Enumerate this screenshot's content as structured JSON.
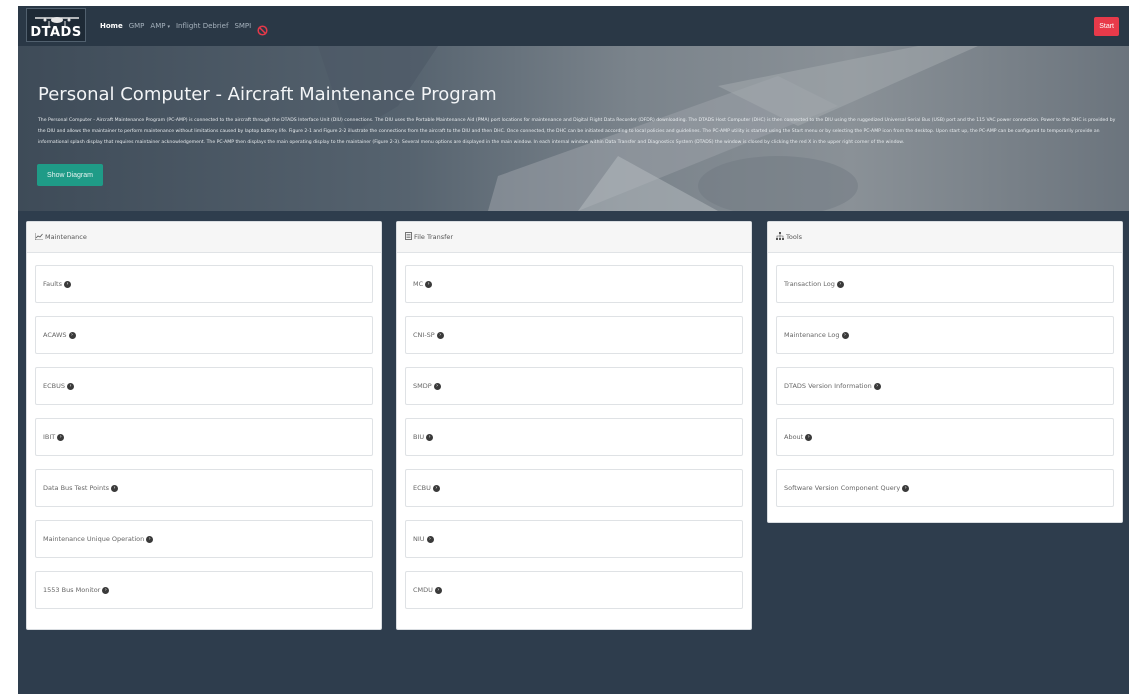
{
  "logo": {
    "text": "DTADS"
  },
  "nav": {
    "items": [
      {
        "label": "Home",
        "active": true
      },
      {
        "label": "GMP",
        "active": false
      },
      {
        "label": "AMP",
        "active": false,
        "dropdown": true
      },
      {
        "label": "Inflight Debrief",
        "active": false
      },
      {
        "label": "SMPI",
        "active": false
      }
    ],
    "caret": "▾",
    "start_label": "Start"
  },
  "hero": {
    "title": "Personal Computer - Aircraft Maintenance Program",
    "description": "The Personal Computer - Aircraft Maintenance Program (PC-AMP) is connected to the aircraft through the DTADS Interface Unit (DIU) connections. The DIU uses the Portable Maintenance Aid (PMA) port locations for maintenance and Digital Flight Data Recorder (DFDR) downloading. The DTADS Host Computer (DHC) is then connected to the DIU using the ruggedized Universal Serial Bus (USB) port and the 115 VAC power connection. Power to the DHC is provided by the DIU and allows the maintainer to perform maintenance without limitations caused by laptop battery life. Figure 2-1 and Figure 2-2 illustrate the connections from the aircraft to the DIU and then DHC. Once connected, the DHC can be initiated according to local policies and guidelines. The PC-AMP utility is started using the Start menu or by selecting the PC-AMP icon from the desktop. Upon start up, the PC-AMP can be configured to temporarily provide an informational splash display that requires maintainer acknowledgement. The PC-AMP then displays the main operating display to the maintainer (Figure 2-3). Several menu options are displayed in the main window. In each internal window within Data Transfer and Diagnostics System (DTADS) the window is closed by clicking the red X in the upper right corner of the window.",
    "button_label": "Show Diagram"
  },
  "panels": [
    {
      "title": "Maintenance",
      "icon": "chart-icon",
      "items": [
        "Faults",
        "ACAWS",
        "ECBUS",
        "IBIT",
        "Data Bus Test Points",
        "Maintenance Unique Operation",
        "1553 Bus Monitor"
      ]
    },
    {
      "title": "File Transfer",
      "icon": "file-icon",
      "items": [
        "MC",
        "CNI-SP",
        "SMDP",
        "BIU",
        "ECBU",
        "NIU",
        "CMDU"
      ]
    },
    {
      "title": "Tools",
      "icon": "sitemap-icon",
      "items": [
        "Transaction Log",
        "Maintenance Log",
        "DTADS Version Information",
        "About",
        "Software Version Component Query"
      ]
    }
  ],
  "chevron": "›",
  "colors": {
    "background": "#2e3d4d",
    "navbar": "#2a3846",
    "start_button": "#e83a4a",
    "show_diagram_button": "#1f9b87",
    "ban_icon": "#e4394a"
  }
}
